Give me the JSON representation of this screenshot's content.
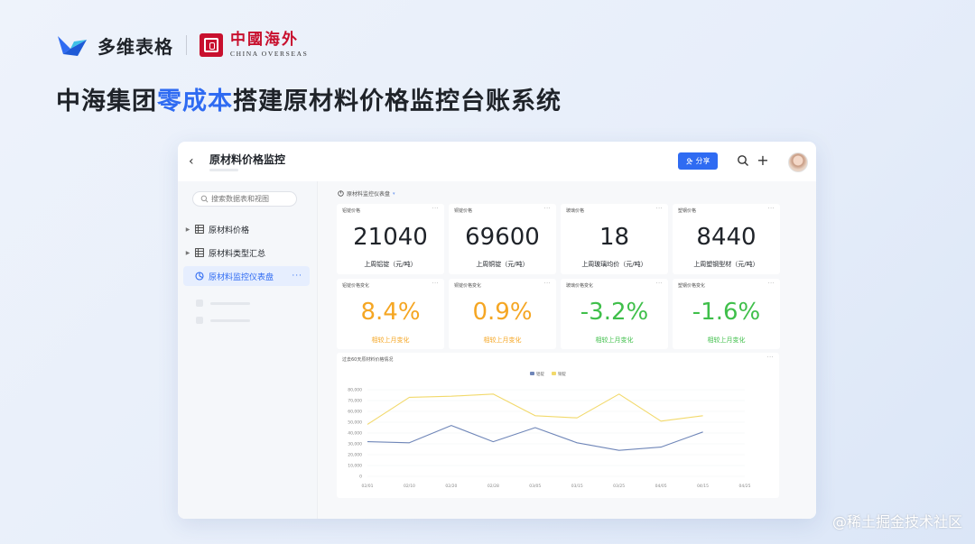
{
  "brand": {
    "name": "多维表格",
    "partner_cn": "中國海外",
    "partner_en": "CHINA OVERSEAS"
  },
  "headline": {
    "part1": "中海集团",
    "highlight": "零成本",
    "part2": "搭建原材料价格监控台账系统"
  },
  "watermark": "@稀土掘金技术社区",
  "app": {
    "title": "原材料价格监控",
    "share_label": "分享",
    "search_placeholder": "搜索数据表和视图",
    "nav": [
      {
        "label": "原材料价格"
      },
      {
        "label": "原材料类型汇总"
      },
      {
        "label": "原材料监控仪表盘",
        "active": true
      }
    ],
    "dashboard_title": "原材料监控仪表盘",
    "price_cards": [
      {
        "label": "铝锭价格",
        "value": "21040",
        "sub": "上周铝锭（元/吨）"
      },
      {
        "label": "铜锭价格",
        "value": "69600",
        "sub": "上周铜锭（元/吨）"
      },
      {
        "label": "玻璃价格",
        "value": "18",
        "sub": "上周玻璃均价（元/吨）"
      },
      {
        "label": "塑钢价格",
        "value": "8440",
        "sub": "上周塑钢型材（元/吨）"
      }
    ],
    "change_cards": [
      {
        "label": "铝锭价格变化",
        "value": "8.4%",
        "sub": "相较上月变化",
        "color": "#f5a623"
      },
      {
        "label": "铜锭价格变化",
        "value": "0.9%",
        "sub": "相较上月变化",
        "color": "#f5a623"
      },
      {
        "label": "玻璃价格变化",
        "value": "-3.2%",
        "sub": "相较上月变化",
        "color": "#3fbf4a"
      },
      {
        "label": "塑钢价格变化",
        "value": "-1.6%",
        "sub": "相较上月变化",
        "color": "#3fbf4a"
      }
    ],
    "chart_title": "过去60天原材料价格情况"
  },
  "chart_data": {
    "type": "line",
    "x": [
      "02/01",
      "02/10",
      "02/20",
      "02/28",
      "03/05",
      "03/15",
      "03/25",
      "04/05",
      "04/15",
      "04/25"
    ],
    "y_ticks": [
      "80,000",
      "70,000",
      "60,000",
      "50,000",
      "40,000",
      "30,000",
      "20,000",
      "10,000",
      "0"
    ],
    "ylim": [
      0,
      80000
    ],
    "series": [
      {
        "name": "铝锭",
        "color": "#6f86b8",
        "values": [
          32000,
          31000,
          47000,
          32000,
          45000,
          31000,
          24000,
          27000,
          41000
        ]
      },
      {
        "name": "铜锭",
        "color": "#f2d96b",
        "values": [
          48000,
          73000,
          74000,
          76000,
          56000,
          54000,
          76000,
          51000,
          56000
        ]
      }
    ]
  },
  "colors": {
    "accent": "#2f6bf2",
    "up": "#f5a623",
    "down": "#3fbf4a"
  }
}
